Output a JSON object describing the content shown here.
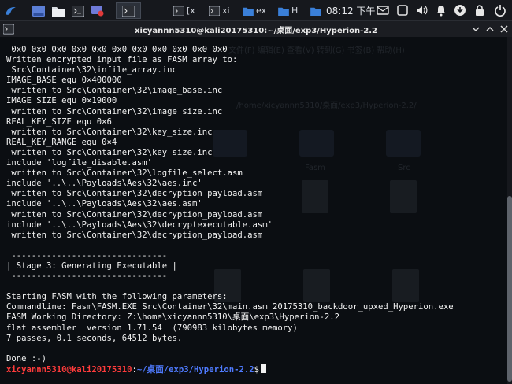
{
  "panel": {
    "clock": "08:12 下午",
    "tasks": [
      {
        "label": "[x",
        "icon": "terminal-icon",
        "active": false
      },
      {
        "label": "xi",
        "icon": "terminal-icon",
        "active": false
      },
      {
        "label": "ex",
        "icon": "folder-icon",
        "active": false
      },
      {
        "label": "H",
        "icon": "folder-icon",
        "active": false
      },
      {
        "label": "",
        "icon": "folder-icon",
        "active": false
      }
    ]
  },
  "window": {
    "title": "xicyannn5310@kali20175310:~/桌面/exp3/Hyperion-2.2"
  },
  "terminal": {
    "lines": [
      " 0x0 0x0 0x0 0x0 0x0 0x0 0x0 0x0 0x0 0x0 0x0",
      "Written encrypted input file as FASM array to:",
      " Src\\Container\\32\\infile_array.inc",
      "IMAGE_BASE equ 0×400000",
      " written to Src\\Container\\32\\image_base.inc",
      "IMAGE_SIZE equ 0×19000",
      " written to Src\\Container\\32\\image_size.inc",
      "REAL_KEY_SIZE equ 0×6",
      " written to Src\\Container\\32\\key_size.inc",
      "REAL_KEY_RANGE equ 0×4",
      " written to Src\\Container\\32\\key_size.inc",
      "include 'logfile_disable.asm'",
      " written to Src\\Container\\32\\logfile_select.asm",
      "include '..\\..\\Payloads\\Aes\\32\\aes.inc'",
      " written to Src\\Container\\32\\decryption_payload.asm",
      "include '..\\..\\Payloads\\Aes\\32\\aes.asm'",
      " written to Src\\Container\\32\\decryption_payload.asm",
      "include '..\\..\\Payloads\\Aes\\32\\decryptexecutable.asm'",
      " written to Src\\Container\\32\\decryption_payload.asm",
      "",
      " -------------------------------",
      "| Stage 3: Generating Executable |",
      " -------------------------------",
      "",
      "Starting FASM with the following parameters:",
      "Commandline: Fasm\\FASM.EXE Src\\Container\\32\\main.asm 20175310_backdoor_upxed_Hyperion.exe",
      "FASM Working Directory: Z:\\home\\xicyannn5310\\桌面\\exp3\\Hyperion-2.2",
      "flat assembler  version 1.71.54  (790983 kilobytes memory)",
      "7 passes, 0.1 seconds, 64512 bytes.",
      "",
      "Done :-)"
    ],
    "prompt_user": "xicyannn5310@kali20175310",
    "prompt_sep": ":",
    "prompt_path": "~/桌面/exp3/Hyperion-2.2",
    "prompt_symbol": "$"
  },
  "desktop_ghost": {
    "toolbar_text": "文件(F)  编辑(E)  查看(V)  转到(G)  书签(B)  帮助(H)",
    "path_text": "/home/xicyannn5310/桌面/exp3/Hyperion-2.2/",
    "items": [
      "Fasm",
      "Src",
      "20175310_backdoor_upxed_Hyperion.exe",
      "Hyperion.exe"
    ]
  }
}
